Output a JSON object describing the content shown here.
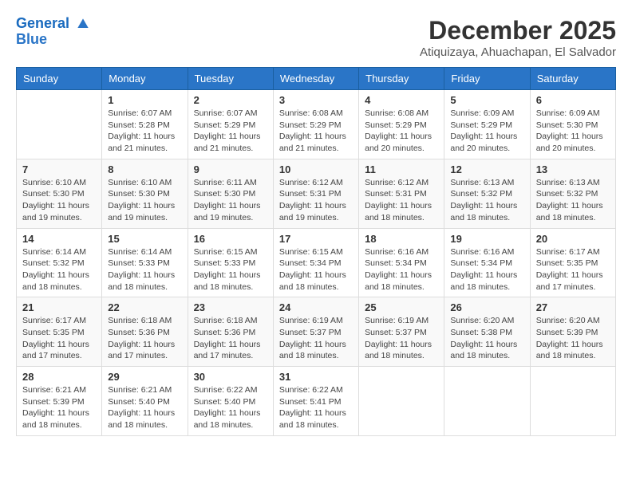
{
  "header": {
    "logo_line1": "General",
    "logo_line2": "Blue",
    "month_title": "December 2025",
    "location": "Atiquizaya, Ahuachapan, El Salvador"
  },
  "weekdays": [
    "Sunday",
    "Monday",
    "Tuesday",
    "Wednesday",
    "Thursday",
    "Friday",
    "Saturday"
  ],
  "weeks": [
    [
      {
        "day": "",
        "sunrise": "",
        "sunset": "",
        "daylight": ""
      },
      {
        "day": "1",
        "sunrise": "Sunrise: 6:07 AM",
        "sunset": "Sunset: 5:28 PM",
        "daylight": "Daylight: 11 hours and 21 minutes."
      },
      {
        "day": "2",
        "sunrise": "Sunrise: 6:07 AM",
        "sunset": "Sunset: 5:29 PM",
        "daylight": "Daylight: 11 hours and 21 minutes."
      },
      {
        "day": "3",
        "sunrise": "Sunrise: 6:08 AM",
        "sunset": "Sunset: 5:29 PM",
        "daylight": "Daylight: 11 hours and 21 minutes."
      },
      {
        "day": "4",
        "sunrise": "Sunrise: 6:08 AM",
        "sunset": "Sunset: 5:29 PM",
        "daylight": "Daylight: 11 hours and 20 minutes."
      },
      {
        "day": "5",
        "sunrise": "Sunrise: 6:09 AM",
        "sunset": "Sunset: 5:29 PM",
        "daylight": "Daylight: 11 hours and 20 minutes."
      },
      {
        "day": "6",
        "sunrise": "Sunrise: 6:09 AM",
        "sunset": "Sunset: 5:30 PM",
        "daylight": "Daylight: 11 hours and 20 minutes."
      }
    ],
    [
      {
        "day": "7",
        "sunrise": "Sunrise: 6:10 AM",
        "sunset": "Sunset: 5:30 PM",
        "daylight": "Daylight: 11 hours and 19 minutes."
      },
      {
        "day": "8",
        "sunrise": "Sunrise: 6:10 AM",
        "sunset": "Sunset: 5:30 PM",
        "daylight": "Daylight: 11 hours and 19 minutes."
      },
      {
        "day": "9",
        "sunrise": "Sunrise: 6:11 AM",
        "sunset": "Sunset: 5:30 PM",
        "daylight": "Daylight: 11 hours and 19 minutes."
      },
      {
        "day": "10",
        "sunrise": "Sunrise: 6:12 AM",
        "sunset": "Sunset: 5:31 PM",
        "daylight": "Daylight: 11 hours and 19 minutes."
      },
      {
        "day": "11",
        "sunrise": "Sunrise: 6:12 AM",
        "sunset": "Sunset: 5:31 PM",
        "daylight": "Daylight: 11 hours and 18 minutes."
      },
      {
        "day": "12",
        "sunrise": "Sunrise: 6:13 AM",
        "sunset": "Sunset: 5:32 PM",
        "daylight": "Daylight: 11 hours and 18 minutes."
      },
      {
        "day": "13",
        "sunrise": "Sunrise: 6:13 AM",
        "sunset": "Sunset: 5:32 PM",
        "daylight": "Daylight: 11 hours and 18 minutes."
      }
    ],
    [
      {
        "day": "14",
        "sunrise": "Sunrise: 6:14 AM",
        "sunset": "Sunset: 5:32 PM",
        "daylight": "Daylight: 11 hours and 18 minutes."
      },
      {
        "day": "15",
        "sunrise": "Sunrise: 6:14 AM",
        "sunset": "Sunset: 5:33 PM",
        "daylight": "Daylight: 11 hours and 18 minutes."
      },
      {
        "day": "16",
        "sunrise": "Sunrise: 6:15 AM",
        "sunset": "Sunset: 5:33 PM",
        "daylight": "Daylight: 11 hours and 18 minutes."
      },
      {
        "day": "17",
        "sunrise": "Sunrise: 6:15 AM",
        "sunset": "Sunset: 5:34 PM",
        "daylight": "Daylight: 11 hours and 18 minutes."
      },
      {
        "day": "18",
        "sunrise": "Sunrise: 6:16 AM",
        "sunset": "Sunset: 5:34 PM",
        "daylight": "Daylight: 11 hours and 18 minutes."
      },
      {
        "day": "19",
        "sunrise": "Sunrise: 6:16 AM",
        "sunset": "Sunset: 5:34 PM",
        "daylight": "Daylight: 11 hours and 18 minutes."
      },
      {
        "day": "20",
        "sunrise": "Sunrise: 6:17 AM",
        "sunset": "Sunset: 5:35 PM",
        "daylight": "Daylight: 11 hours and 17 minutes."
      }
    ],
    [
      {
        "day": "21",
        "sunrise": "Sunrise: 6:17 AM",
        "sunset": "Sunset: 5:35 PM",
        "daylight": "Daylight: 11 hours and 17 minutes."
      },
      {
        "day": "22",
        "sunrise": "Sunrise: 6:18 AM",
        "sunset": "Sunset: 5:36 PM",
        "daylight": "Daylight: 11 hours and 17 minutes."
      },
      {
        "day": "23",
        "sunrise": "Sunrise: 6:18 AM",
        "sunset": "Sunset: 5:36 PM",
        "daylight": "Daylight: 11 hours and 17 minutes."
      },
      {
        "day": "24",
        "sunrise": "Sunrise: 6:19 AM",
        "sunset": "Sunset: 5:37 PM",
        "daylight": "Daylight: 11 hours and 18 minutes."
      },
      {
        "day": "25",
        "sunrise": "Sunrise: 6:19 AM",
        "sunset": "Sunset: 5:37 PM",
        "daylight": "Daylight: 11 hours and 18 minutes."
      },
      {
        "day": "26",
        "sunrise": "Sunrise: 6:20 AM",
        "sunset": "Sunset: 5:38 PM",
        "daylight": "Daylight: 11 hours and 18 minutes."
      },
      {
        "day": "27",
        "sunrise": "Sunrise: 6:20 AM",
        "sunset": "Sunset: 5:39 PM",
        "daylight": "Daylight: 11 hours and 18 minutes."
      }
    ],
    [
      {
        "day": "28",
        "sunrise": "Sunrise: 6:21 AM",
        "sunset": "Sunset: 5:39 PM",
        "daylight": "Daylight: 11 hours and 18 minutes."
      },
      {
        "day": "29",
        "sunrise": "Sunrise: 6:21 AM",
        "sunset": "Sunset: 5:40 PM",
        "daylight": "Daylight: 11 hours and 18 minutes."
      },
      {
        "day": "30",
        "sunrise": "Sunrise: 6:22 AM",
        "sunset": "Sunset: 5:40 PM",
        "daylight": "Daylight: 11 hours and 18 minutes."
      },
      {
        "day": "31",
        "sunrise": "Sunrise: 6:22 AM",
        "sunset": "Sunset: 5:41 PM",
        "daylight": "Daylight: 11 hours and 18 minutes."
      },
      {
        "day": "",
        "sunrise": "",
        "sunset": "",
        "daylight": ""
      },
      {
        "day": "",
        "sunrise": "",
        "sunset": "",
        "daylight": ""
      },
      {
        "day": "",
        "sunrise": "",
        "sunset": "",
        "daylight": ""
      }
    ]
  ]
}
